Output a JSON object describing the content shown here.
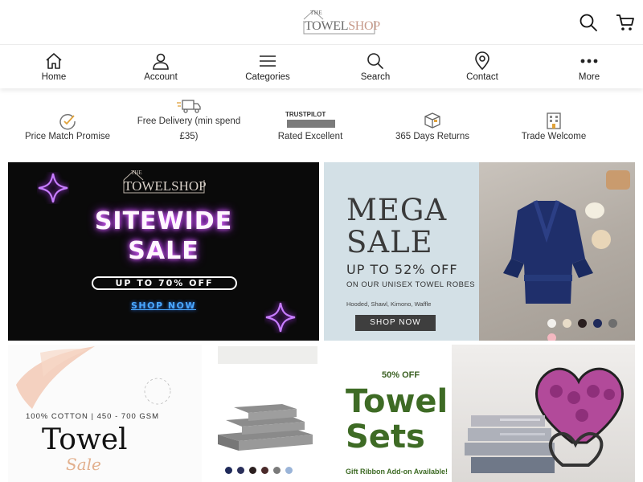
{
  "header": {
    "logo_top": "THE",
    "logo_name_a": "TOWEL",
    "logo_name_b": "SHOP",
    "icons": [
      "search-icon",
      "cart-icon"
    ]
  },
  "nav": {
    "items": [
      {
        "label": "Home",
        "icon": "home-icon"
      },
      {
        "label": "Account",
        "icon": "user-icon"
      },
      {
        "label": "Categories",
        "icon": "menu-icon"
      },
      {
        "label": "Search",
        "icon": "search-icon"
      },
      {
        "label": "Contact",
        "icon": "location-pin-icon"
      },
      {
        "label": "More",
        "icon": "more-dots-icon"
      }
    ]
  },
  "usps": {
    "price_match": "Price Match Promise",
    "delivery_line1": "Free Delivery (min spend",
    "delivery_line2": "£35)",
    "trustpilot_logo": "TRUSTPILOT",
    "rated": "Rated Excellent",
    "returns": "365 Days Returns",
    "trade": "Trade Welcome"
  },
  "banners": {
    "sitewide": {
      "logo_top": "THE",
      "logo_name": "TOWELSHOP",
      "line1": "SITEWIDE",
      "line2": "SALE",
      "offer": "UP TO 70% OFF",
      "cta": "SHOP NOW"
    },
    "mega": {
      "line1": "MEGA",
      "line2": "SALE",
      "offer": "UP TO 52% OFF",
      "sub": "ON OUR UNISEX TOWEL ROBES",
      "styles": "Hooded, Shawl, Kimono, Waffle",
      "cta": "SHOP NOW",
      "swatch_colors": [
        "#f2f0ec",
        "#e8dcc8",
        "#2a1f1f",
        "#1f2a5a",
        "#6e6e6e",
        "#f4b8c0"
      ]
    },
    "cotton": {
      "spec": "100% COTTON | 450 - 700 GSM",
      "title": "Towel",
      "script": "Sale",
      "swatch_colors": [
        "#1f2a5a",
        "#2a2f5a",
        "#2b1f1f",
        "#4a2a2a",
        "#7a7a7a",
        "#9ab4d8"
      ]
    },
    "sets": {
      "discount": "50% OFF",
      "line1": "Towel",
      "line2": "Sets",
      "gift": "Gift Ribbon Add-on Available!"
    }
  },
  "colors": {
    "neon_purple": "#b233ff",
    "neon_blue": "#4aa8ff",
    "green": "#3e6b25",
    "robe_blue": "#1f2f6b"
  }
}
